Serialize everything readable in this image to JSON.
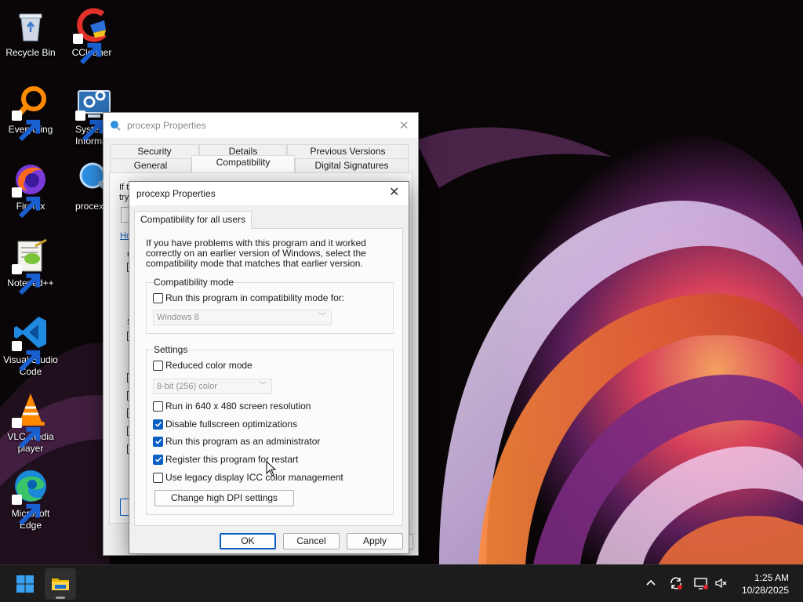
{
  "desktop": {
    "icons": [
      {
        "label": "Recycle Bin",
        "icon": "recycle-bin-icon"
      },
      {
        "label": "CCleaner",
        "icon": "ccleaner-icon"
      },
      {
        "label": "Everything",
        "icon": "everything-icon"
      },
      {
        "label": "System Information",
        "icon": "system-information-icon"
      },
      {
        "label": "Firefox",
        "icon": "firefox-icon"
      },
      {
        "label": "procexp",
        "icon": "procexp-icon"
      },
      {
        "label": "Notepad++",
        "icon": "notepadpp-icon"
      },
      {
        "label": "Visual Studio Code",
        "icon": "vscode-icon"
      },
      {
        "label": "VLC media player",
        "icon": "vlc-icon"
      },
      {
        "label": "Microsoft Edge",
        "icon": "edge-icon"
      }
    ]
  },
  "back_window": {
    "title": "procexp Properties",
    "tabs_top": [
      "Security",
      "Details",
      "Previous Versions"
    ],
    "tabs_bottom": [
      "General",
      "Compatibility",
      "Digital Signatures"
    ],
    "active_tab": "Compatibility",
    "stubs": {
      "line1": "If th",
      "line2": "try",
      "link": "Ho",
      "g1": "C",
      "g2": "S"
    }
  },
  "front_dialog": {
    "title": "procexp Properties",
    "tab": "Compatibility for all users",
    "intro": "If you have problems with this program and it worked correctly on an earlier version of Windows, select the compatibility mode that matches that earlier version.",
    "compat_mode": {
      "group_label": "Compatibility mode",
      "checkbox_label": "Run this program in compatibility mode for:",
      "checked": false,
      "select_value": "Windows 8"
    },
    "settings": {
      "group_label": "Settings",
      "reduced_color": {
        "label": "Reduced color mode",
        "checked": false
      },
      "color_select_value": "8-bit (256) color",
      "run_640": {
        "label": "Run in 640 x 480 screen resolution",
        "checked": false
      },
      "disable_fullscreen": {
        "label": "Disable fullscreen optimizations",
        "checked": true
      },
      "run_admin": {
        "label": "Run this program as an administrator",
        "checked": true
      },
      "register_restart": {
        "label": "Register this program for restart",
        "checked": true
      },
      "legacy_icc": {
        "label": "Use legacy display ICC color management",
        "checked": false
      },
      "dpi_button": "Change high DPI settings"
    },
    "buttons": {
      "ok": "OK",
      "cancel": "Cancel",
      "apply": "Apply"
    }
  },
  "taskbar": {
    "time": "1:25 AM",
    "date": "10/28/2025",
    "pinned": [
      "start-icon",
      "file-explorer-icon"
    ],
    "tray": [
      "chevron-up-icon",
      "sync-icon",
      "display-icon",
      "volume-muted-icon"
    ]
  },
  "colors": {
    "accent": "#0a5fc4",
    "taskbar": "#1c1c1c",
    "dialog_bg": "#f0f0f0"
  }
}
